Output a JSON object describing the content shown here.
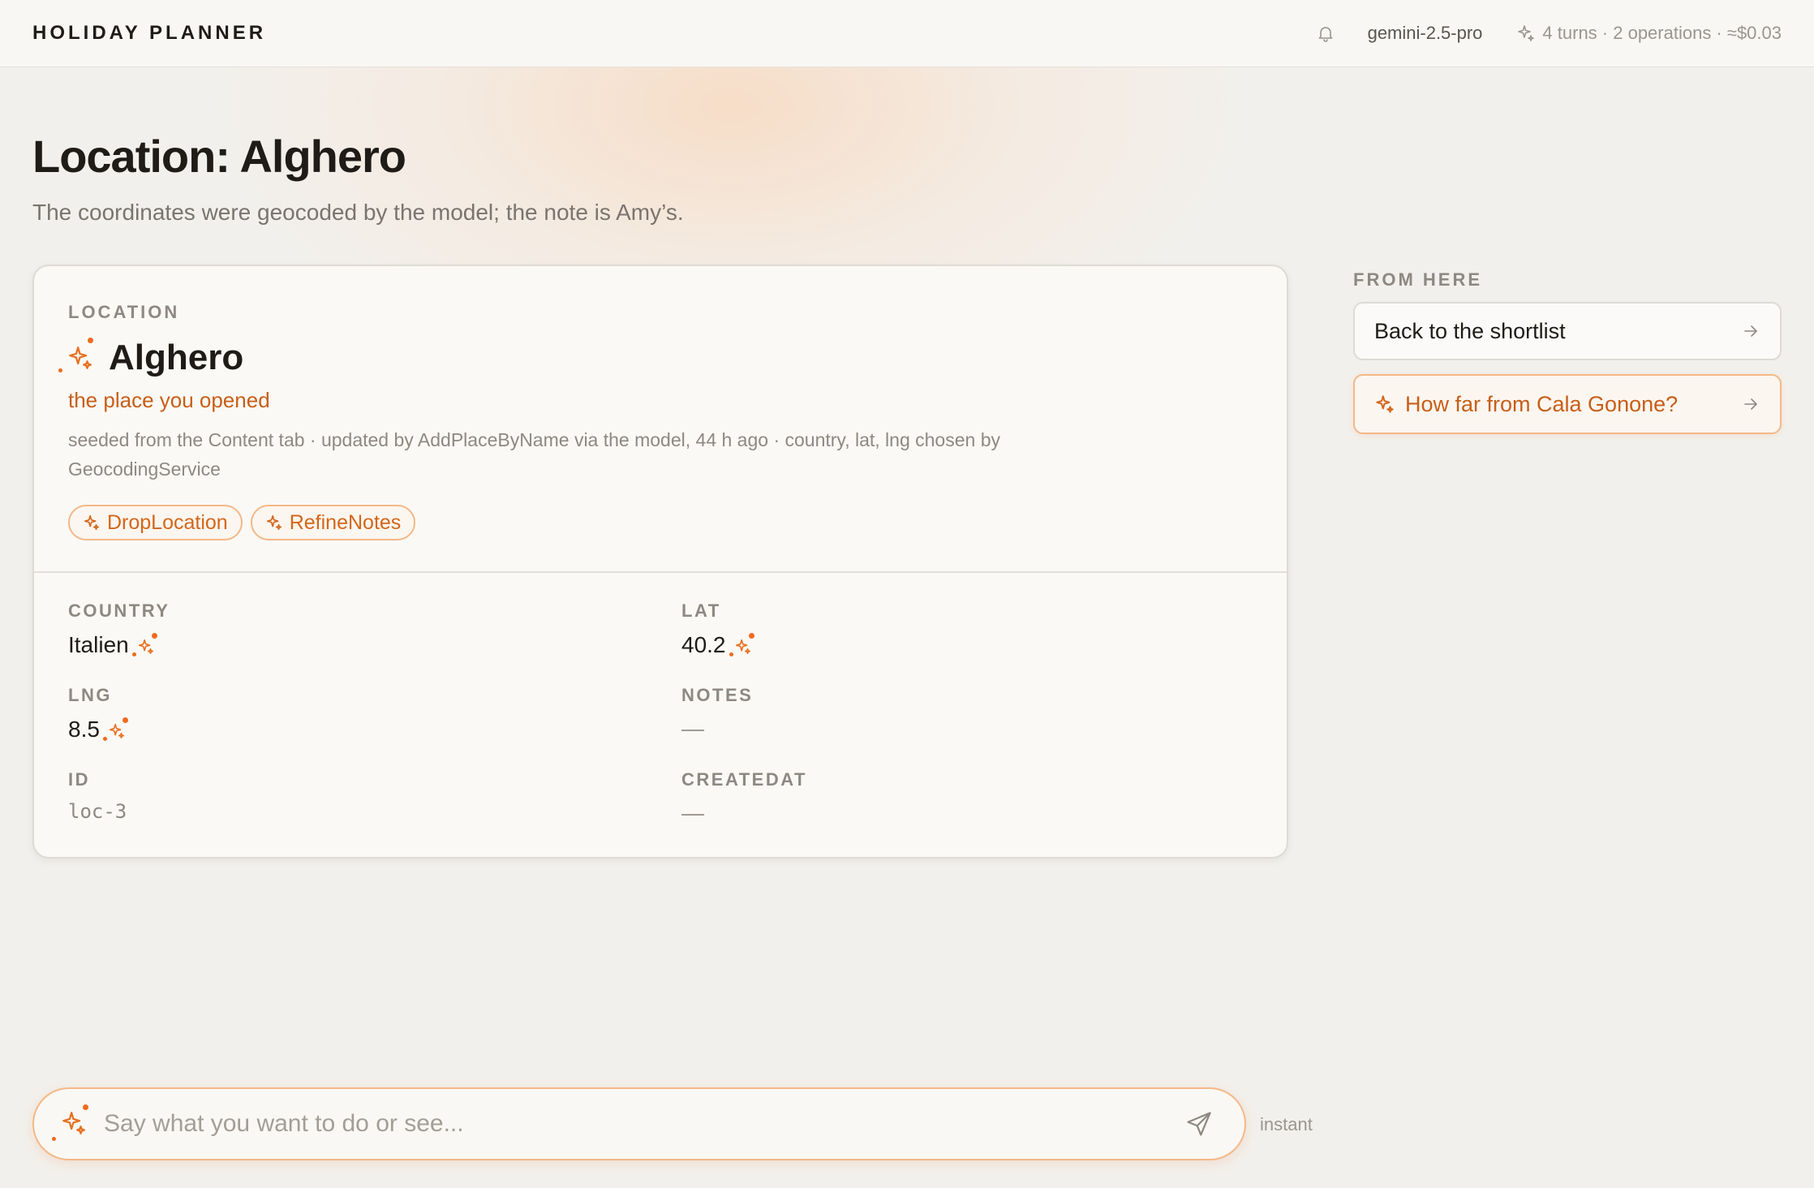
{
  "header": {
    "brand": "HOLIDAY PLANNER",
    "model": "gemini-2.5-pro",
    "usage": "4 turns · 2 operations · ≈$0.03"
  },
  "page": {
    "title": "Location: Alghero",
    "subtitle": "The coordinates were geocoded by the model; the note is Amy’s."
  },
  "card": {
    "eyebrow": "LOCATION",
    "name": "Alghero",
    "tagline": "the place you opened",
    "meta": "seeded from the Content tab · updated by AddPlaceByName via the model, 44 h ago · country, lat, lng chosen by GeocodingService",
    "actions": [
      "DropLocation",
      "RefineNotes"
    ],
    "fields": {
      "country": {
        "label": "COUNTRY",
        "value": "Italien"
      },
      "lat": {
        "label": "LAT",
        "value": "40.2"
      },
      "lng": {
        "label": "LNG",
        "value": "8.5"
      },
      "notes": {
        "label": "NOTES",
        "value": "—"
      },
      "id": {
        "label": "ID",
        "value": "loc-3"
      },
      "createdat": {
        "label": "CREATEDAT",
        "value": "—"
      }
    }
  },
  "sidebar": {
    "eyebrow": "FROM HERE",
    "links": [
      {
        "label": "Back to the shortlist"
      },
      {
        "label": "How far from Cala Gonone?"
      }
    ]
  },
  "chat": {
    "placeholder": "Say what you want to do or see...",
    "mode": "instant"
  },
  "icons": {
    "sparkle": "sparkle-icon",
    "bell": "bell-icon",
    "arrow": "arrow-right-icon",
    "send": "send-icon"
  },
  "colors": {
    "accent": "#e8701f",
    "accent_text": "#c85e17",
    "accent_border": "#f4b887",
    "background": "#f2f0ec"
  }
}
